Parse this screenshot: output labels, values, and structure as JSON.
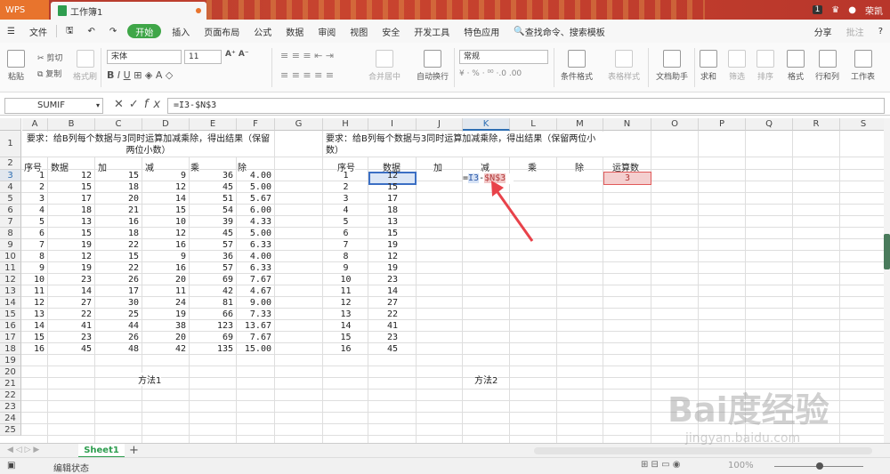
{
  "tabs": {
    "wps": "WPS",
    "doc": "工作簿1"
  },
  "titlebar_right": {
    "badge": "1",
    "user": "荣凯"
  },
  "menu": {
    "file": "文件",
    "items": [
      "开始",
      "插入",
      "页面布局",
      "公式",
      "数据",
      "审阅",
      "视图",
      "安全",
      "开发工具",
      "特色应用"
    ],
    "active": "开始",
    "search": "查找命令、搜索模板",
    "share": "分享",
    "comment": "批注"
  },
  "ribbon": {
    "paste": "粘贴",
    "cut": "剪切",
    "copy": "复制",
    "format_painter": "格式刷",
    "font_name": "宋体",
    "font_size": "11",
    "merge": "合并居中",
    "wrap": "自动换行",
    "number_format": "常规",
    "conditional": "条件格式",
    "table_style": "表格样式",
    "doc_helper": "文档助手",
    "sum": "求和",
    "filter": "筛选",
    "sort": "排序",
    "format": "格式",
    "row_col": "行和列",
    "worksheet": "工作表"
  },
  "formula_bar": {
    "name_box": "SUMIF",
    "formula": "=I3-$N$3",
    "fx": "fx"
  },
  "columns": [
    "A",
    "B",
    "C",
    "D",
    "E",
    "F",
    "G",
    "H",
    "I",
    "J",
    "K",
    "L",
    "M",
    "N",
    "O",
    "P",
    "Q",
    "R",
    "S"
  ],
  "rows": [
    "1",
    "2",
    "3",
    "4",
    "5",
    "6",
    "7",
    "8",
    "9",
    "10",
    "11",
    "12",
    "13",
    "14",
    "15",
    "16",
    "17",
    "18",
    "19",
    "20",
    "21",
    "22",
    "23",
    "24",
    "25"
  ],
  "left_table": {
    "title": "要求：给B列每个数据与3同时运算加减乘除，得出结果（保留两位小数）",
    "headers": [
      "序号",
      "数据",
      "加",
      "减",
      "乘",
      "除"
    ],
    "rows": [
      [
        "1",
        "12",
        "15",
        "9",
        "36",
        "4.00"
      ],
      [
        "2",
        "15",
        "18",
        "12",
        "45",
        "5.00"
      ],
      [
        "3",
        "17",
        "20",
        "14",
        "51",
        "5.67"
      ],
      [
        "4",
        "18",
        "21",
        "15",
        "54",
        "6.00"
      ],
      [
        "5",
        "13",
        "16",
        "10",
        "39",
        "4.33"
      ],
      [
        "6",
        "15",
        "18",
        "12",
        "45",
        "5.00"
      ],
      [
        "7",
        "19",
        "22",
        "16",
        "57",
        "6.33"
      ],
      [
        "8",
        "12",
        "15",
        "9",
        "36",
        "4.00"
      ],
      [
        "9",
        "19",
        "22",
        "16",
        "57",
        "6.33"
      ],
      [
        "10",
        "23",
        "26",
        "20",
        "69",
        "7.67"
      ],
      [
        "11",
        "14",
        "17",
        "11",
        "42",
        "4.67"
      ],
      [
        "12",
        "27",
        "30",
        "24",
        "81",
        "9.00"
      ],
      [
        "13",
        "22",
        "25",
        "19",
        "66",
        "7.33"
      ],
      [
        "14",
        "41",
        "44",
        "38",
        "123",
        "13.67"
      ],
      [
        "15",
        "23",
        "26",
        "20",
        "69",
        "7.67"
      ],
      [
        "16",
        "45",
        "48",
        "42",
        "135",
        "15.00"
      ]
    ],
    "method": "方法1"
  },
  "right_table": {
    "title": "要求：给B列每个数据与3同时运算加减乘除，得出结果（保留两位小数）",
    "headers": [
      "序号",
      "数据",
      "加",
      "减",
      "乘",
      "除",
      "运算数"
    ],
    "operand": "3",
    "editing": {
      "eq": "=",
      "ref1": "I3",
      "op": "-",
      "ref2": "$N$3"
    },
    "rows": [
      [
        "1",
        "12"
      ],
      [
        "2",
        "15"
      ],
      [
        "3",
        "17"
      ],
      [
        "4",
        "18"
      ],
      [
        "5",
        "13"
      ],
      [
        "6",
        "15"
      ],
      [
        "7",
        "19"
      ],
      [
        "8",
        "12"
      ],
      [
        "9",
        "19"
      ],
      [
        "10",
        "23"
      ],
      [
        "11",
        "14"
      ],
      [
        "12",
        "27"
      ],
      [
        "13",
        "22"
      ],
      [
        "14",
        "41"
      ],
      [
        "15",
        "23"
      ],
      [
        "16",
        "45"
      ]
    ],
    "method": "方法2"
  },
  "sheet_tab": "Sheet1",
  "status": {
    "mode": "编辑状态",
    "zoom": "100%"
  },
  "watermark": {
    "brand": "Bai度经验",
    "url": "jingyan.baidu.com"
  },
  "colors": {
    "accent": "#3fa648",
    "titlebar": "#c0392b",
    "wps_tab": "#e8742d",
    "arrow": "#e8424a"
  }
}
